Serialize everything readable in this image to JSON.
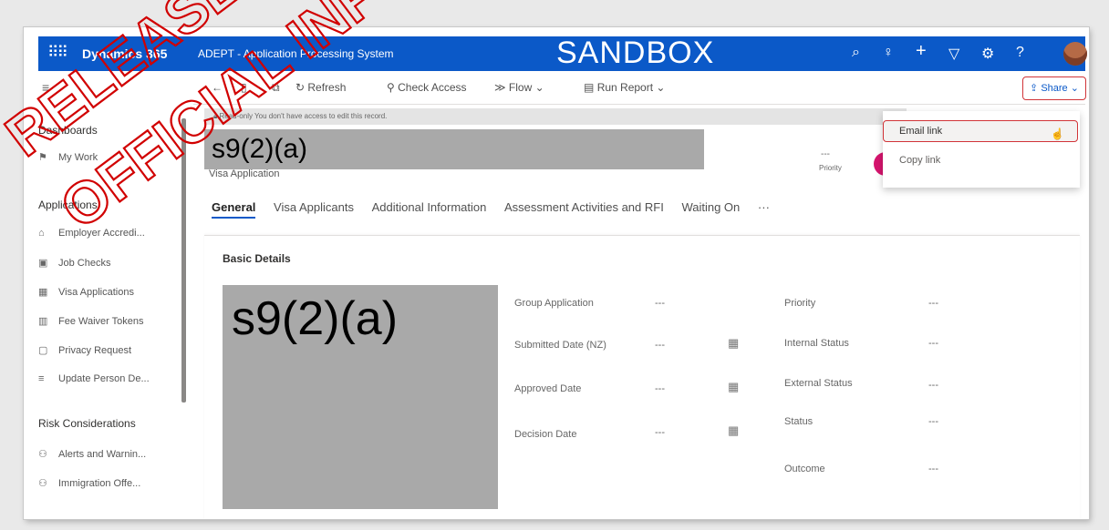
{
  "topbar": {
    "brand": "Dynamics 365",
    "app_name": "ADEPT - Application Processing System",
    "environment": "SANDBOX",
    "color": "#0b59c8"
  },
  "commands": {
    "back": "←",
    "refresh": "Refresh",
    "check_access": "Check Access",
    "flow": "Flow",
    "run_report": "Run Report",
    "share": "Share"
  },
  "sidebar": {
    "groups": [
      {
        "title": "Dashboards",
        "items": [
          {
            "label": "My Work",
            "icon": "pin-icon"
          }
        ]
      },
      {
        "title": "Applications",
        "items": [
          {
            "label": "Employer Accredi...",
            "icon": "building-icon"
          },
          {
            "label": "Job Checks",
            "icon": "briefcase-icon"
          },
          {
            "label": "Visa Applications",
            "icon": "calendar-icon"
          },
          {
            "label": "Fee Waiver Tokens",
            "icon": "token-icon"
          },
          {
            "label": "Privacy Request",
            "icon": "document-icon"
          },
          {
            "label": "Update Person De...",
            "icon": "list-icon"
          }
        ]
      },
      {
        "title": "Risk Considerations",
        "items": [
          {
            "label": "Alerts and Warnin...",
            "icon": "link-icon"
          },
          {
            "label": "Immigration Offe...",
            "icon": "link-icon"
          }
        ]
      }
    ]
  },
  "notice": "Read-only You don't have access to edit this record.",
  "record": {
    "redaction_top": "s9(2)(a)",
    "entity": "Visa Application",
    "header_priority_value": "---",
    "header_priority_label": "Priority"
  },
  "tabs": [
    "General",
    "Visa Applicants",
    "Additional Information",
    "Assessment Activities and RFI",
    "Waiting On",
    "···"
  ],
  "basic_details": {
    "title": "Basic Details",
    "redaction": "s9(2)(a)",
    "group_application": {
      "label": "Group Application",
      "value": "---"
    },
    "submitted_date": {
      "label": "Submitted Date (NZ)",
      "value": "---"
    },
    "approved_date": {
      "label": "Approved Date",
      "value": "---"
    },
    "decision_date": {
      "label": "Decision Date",
      "value": "---"
    },
    "priority": {
      "label": "Priority",
      "value": "---"
    },
    "internal_status": {
      "label": "Internal Status",
      "value": "---"
    },
    "external_status": {
      "label": "External Status",
      "value": "---"
    },
    "status": {
      "label": "Status",
      "value": "---"
    },
    "outcome": {
      "label": "Outcome",
      "value": "---"
    }
  },
  "share_menu": {
    "email_link": "Email link",
    "copy_link": "Copy link"
  },
  "watermark": {
    "line1": "RELEASED UNDER THE",
    "line2": "OFFICIAL INFORMATION",
    "color": "#d10000"
  }
}
